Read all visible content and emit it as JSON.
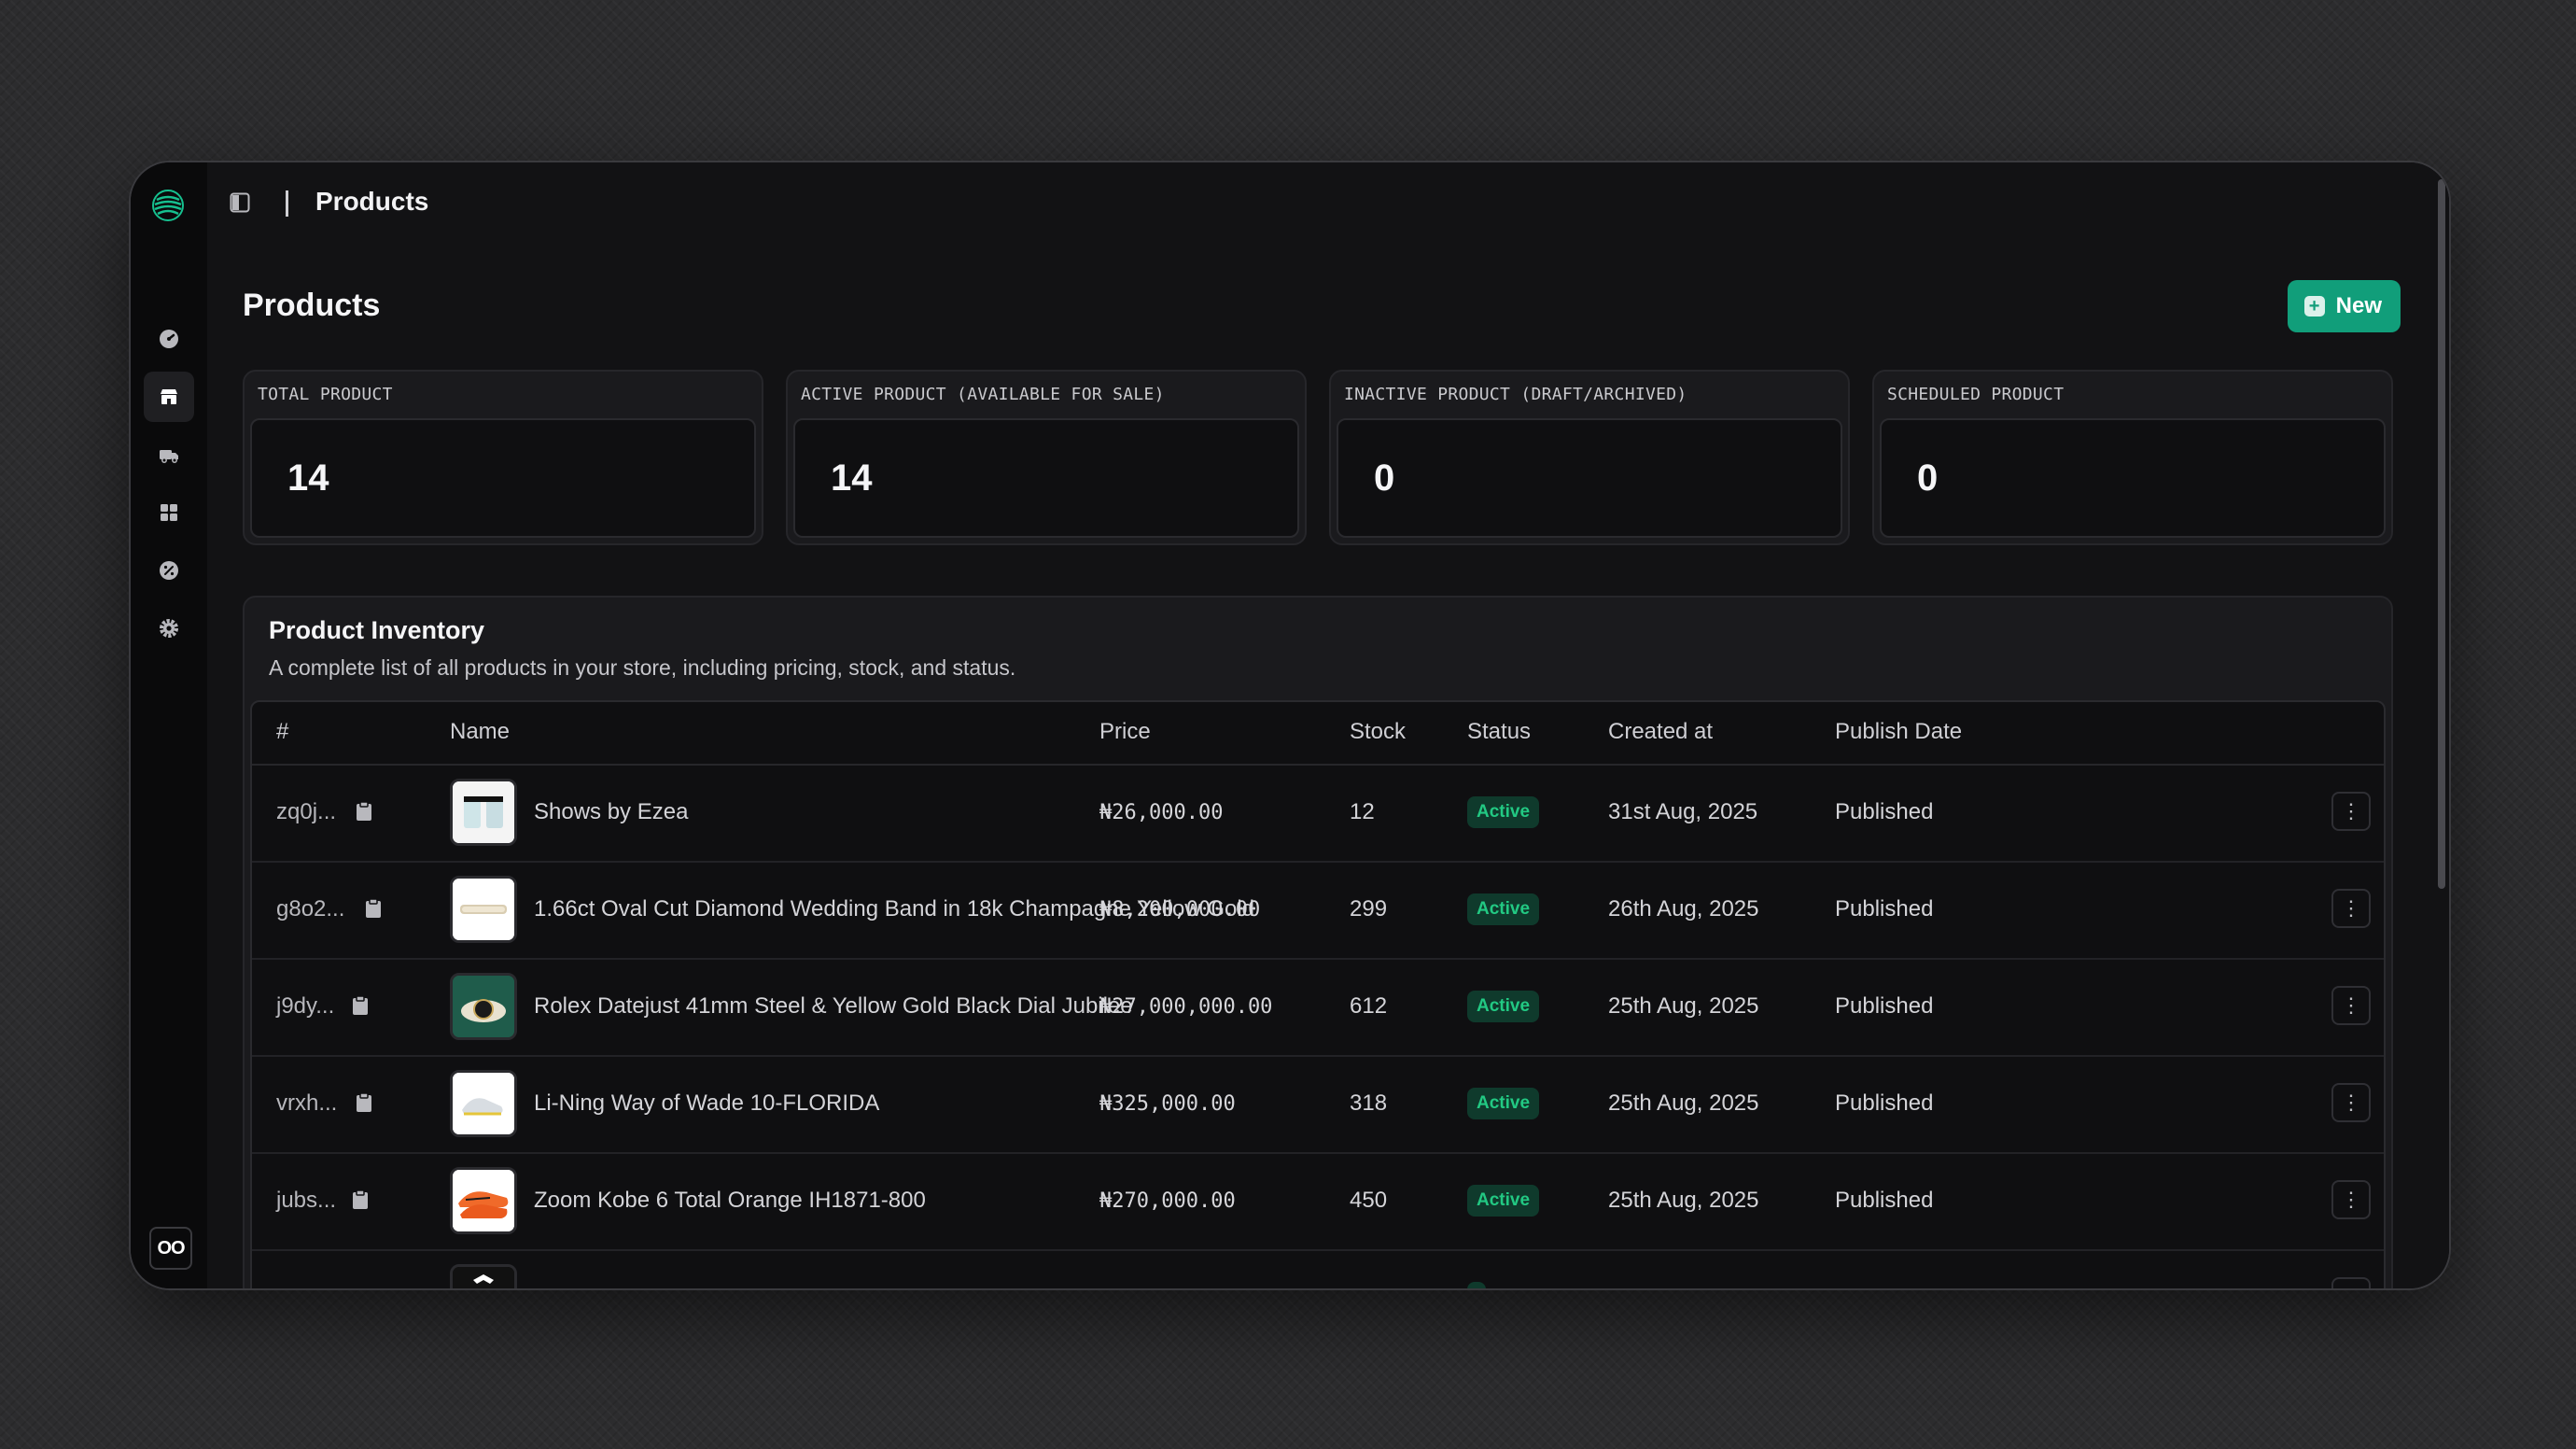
{
  "header": {
    "breadcrumb": "Products"
  },
  "page": {
    "title": "Products",
    "new_button": "New"
  },
  "stats": [
    {
      "label": "TOTAL PRODUCT",
      "value": "14"
    },
    {
      "label": "ACTIVE PRODUCT (AVAILABLE FOR SALE)",
      "value": "14"
    },
    {
      "label": "INACTIVE PRODUCT (DRAFT/ARCHIVED)",
      "value": "0"
    },
    {
      "label": "SCHEDULED PRODUCT",
      "value": "0"
    }
  ],
  "inventory": {
    "title": "Product Inventory",
    "subtitle": "A complete list of all products in your store, including pricing, stock, and status.",
    "columns": {
      "id": "#",
      "name": "Name",
      "price": "Price",
      "stock": "Stock",
      "status": "Status",
      "created": "Created at",
      "publish": "Publish Date"
    },
    "rows": [
      {
        "id": "zq0j...",
        "name": "Shows by Ezea",
        "price": "₦26,000.00",
        "stock": "12",
        "status": "Active",
        "created": "31st Aug, 2025",
        "publish": "Published"
      },
      {
        "id": "g8o2...",
        "name": "1.66ct Oval Cut Diamond Wedding Band in 18k Champagne Yellow Gold",
        "price": "₦8,200,000.00",
        "stock": "299",
        "status": "Active",
        "created": "26th Aug, 2025",
        "publish": "Published"
      },
      {
        "id": "j9dy...",
        "name": "Rolex Datejust 41mm Steel & Yellow Gold Black Dial Jubilee",
        "price": "₦27,000,000.00",
        "stock": "612",
        "status": "Active",
        "created": "25th Aug, 2025",
        "publish": "Published"
      },
      {
        "id": "vrxh...",
        "name": "Li-Ning Way of Wade 10-FLORIDA",
        "price": "₦325,000.00",
        "stock": "318",
        "status": "Active",
        "created": "25th Aug, 2025",
        "publish": "Published"
      },
      {
        "id": "jubs...",
        "name": "Zoom Kobe 6 Total Orange IH1871-800",
        "price": "₦270,000.00",
        "stock": "450",
        "status": "Active",
        "created": "25th Aug, 2025",
        "publish": "Published"
      }
    ]
  },
  "sidebar": {
    "items": [
      {
        "icon": "dashboard-icon"
      },
      {
        "icon": "store-icon",
        "active": true
      },
      {
        "icon": "orders-icon"
      },
      {
        "icon": "grid-icon"
      },
      {
        "icon": "discount-icon"
      },
      {
        "icon": "settings-icon"
      }
    ],
    "footer_logo": "OO"
  },
  "colors": {
    "accent": "#119e7a",
    "active_badge_text": "#22c983",
    "active_badge_bg": "#0f3a2c"
  }
}
